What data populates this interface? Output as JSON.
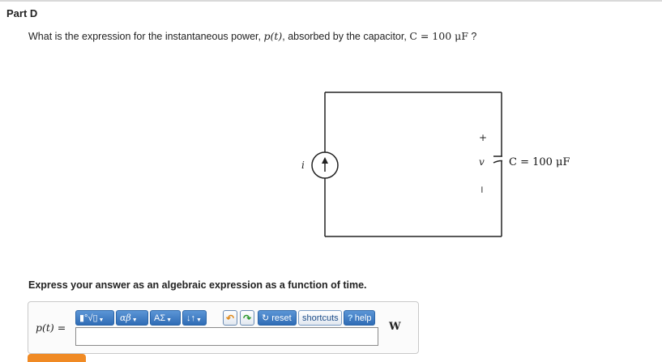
{
  "part_title": "Part D",
  "question": {
    "prefix": "What is the expression for the instantaneous power,",
    "var": "p(t)",
    "middle": ", absorbed by the capacitor,",
    "cap_expr": "C = 100 μF",
    "suffix": "?"
  },
  "circuit": {
    "current_label": "i",
    "voltage_label": "v",
    "plus_sign": "+",
    "minus_sign": "−",
    "capacitor_label": "C = 100 μF"
  },
  "instruction": "Express your answer as an algebraic expression as a function of time.",
  "answer": {
    "variable_label": "p(t) =",
    "unit": "W",
    "input_value": ""
  },
  "toolbar": {
    "templates_label": "▮°√▯",
    "greek_label": "αβ",
    "symbols_label": "ΑΣ",
    "arrows_label": "↓↑",
    "undo_icon": "undo-icon",
    "redo_icon": "redo-icon",
    "reset_label": "reset",
    "shortcuts_label": "shortcuts",
    "help_label": "help"
  },
  "colors": {
    "toolbar_blue": "#2f6cb5",
    "submit_orange": "#f08a24"
  }
}
